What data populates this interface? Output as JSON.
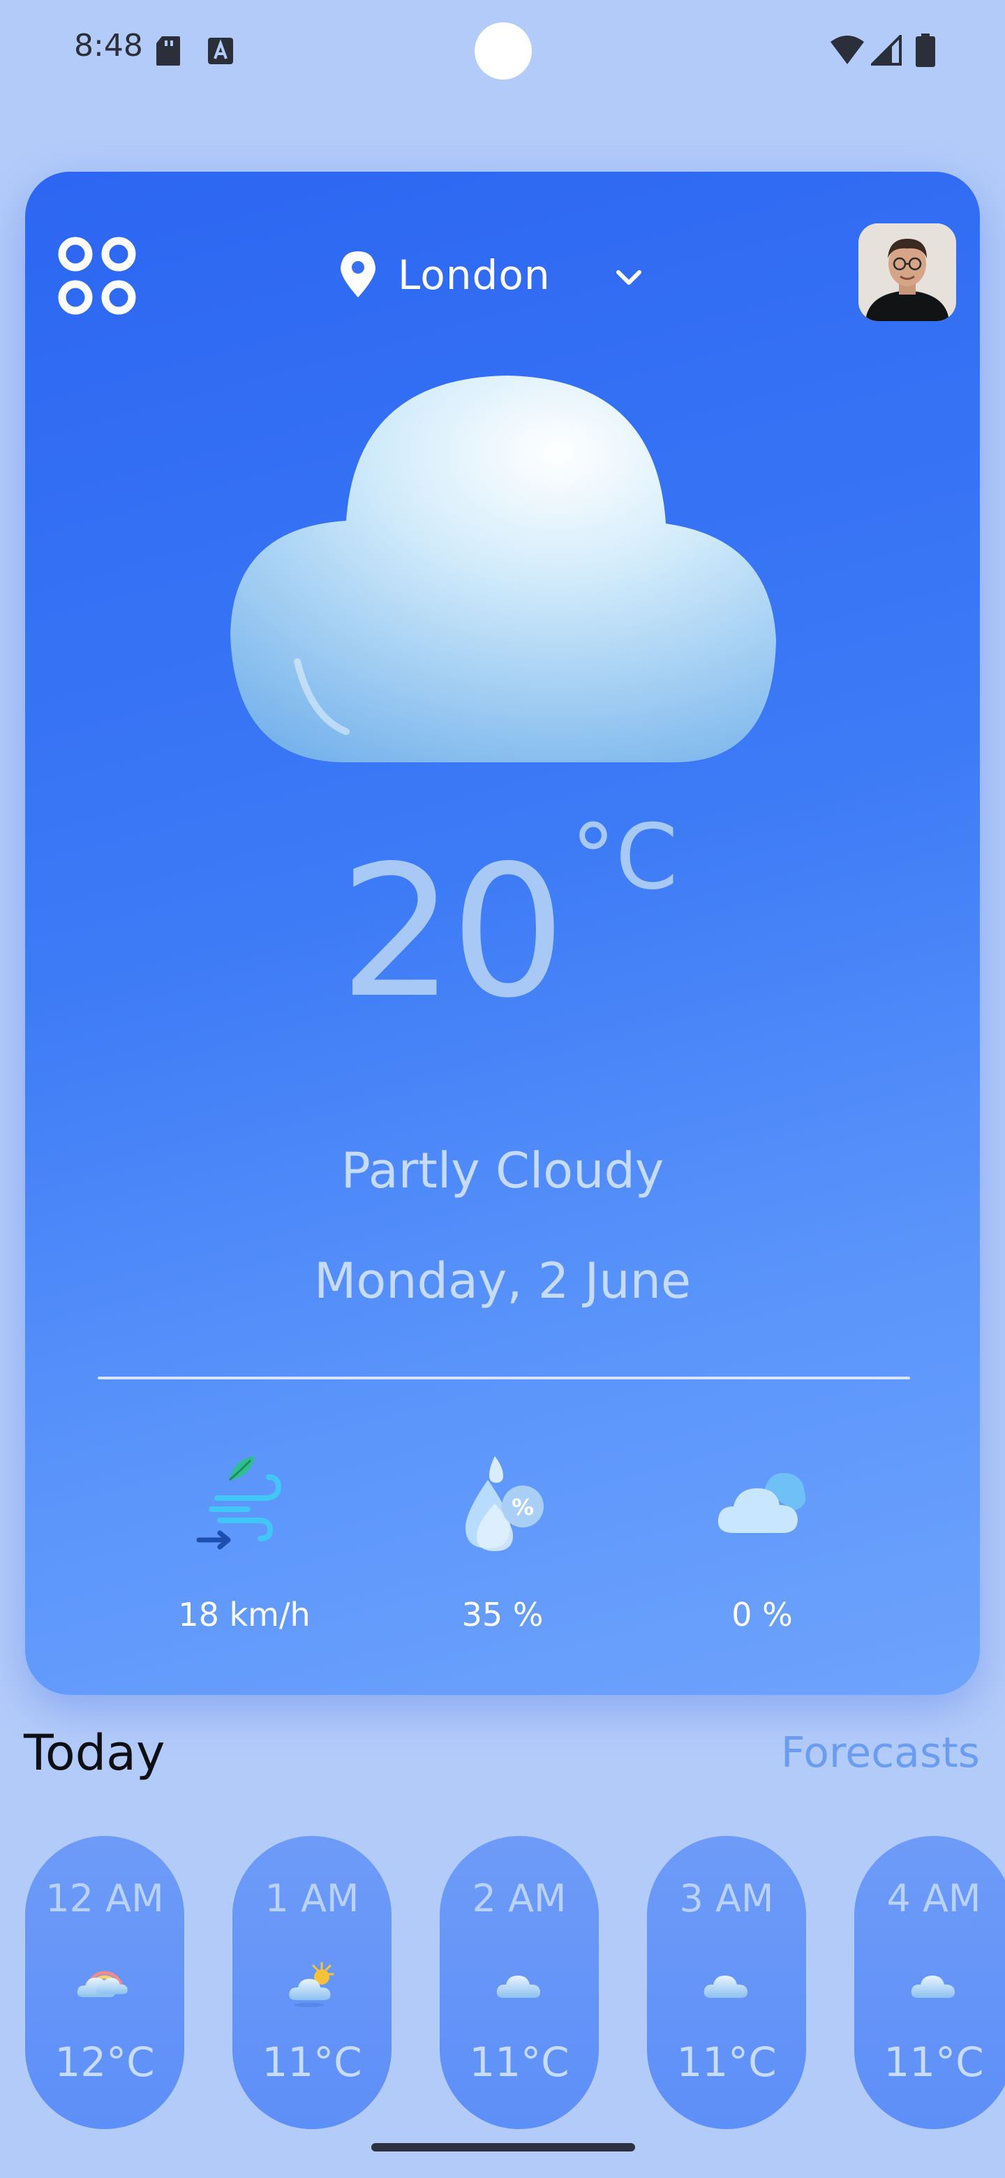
{
  "status_bar": {
    "time": "8:48"
  },
  "header": {
    "location": "London"
  },
  "current": {
    "temperature": "20",
    "unit": "°C",
    "condition": "Partly Cloudy",
    "date": "Monday, 2 June"
  },
  "metrics": [
    {
      "icon": "wind-icon",
      "value": "18 km/h"
    },
    {
      "icon": "humidity-icon",
      "value": "35 %"
    },
    {
      "icon": "cloud-cover-icon",
      "value": "0 %"
    }
  ],
  "today": {
    "title": "Today",
    "forecasts_link": "Forecasts"
  },
  "hourly": [
    {
      "time": "12 AM",
      "icon": "rainbow-cloud-icon",
      "temp": "12°C"
    },
    {
      "time": "1 AM",
      "icon": "sun-cloud-icon",
      "temp": "11°C"
    },
    {
      "time": "2 AM",
      "icon": "cloud-icon",
      "temp": "11°C"
    },
    {
      "time": "3 AM",
      "icon": "cloud-icon",
      "temp": "11°C"
    },
    {
      "time": "4 AM",
      "icon": "cloud-icon",
      "temp": "11°C"
    }
  ],
  "colors": {
    "background": "#b3cbf9",
    "card_top": "#2c66f2",
    "card_bottom": "#6ea3fd",
    "accent_link": "#6a9df0"
  }
}
